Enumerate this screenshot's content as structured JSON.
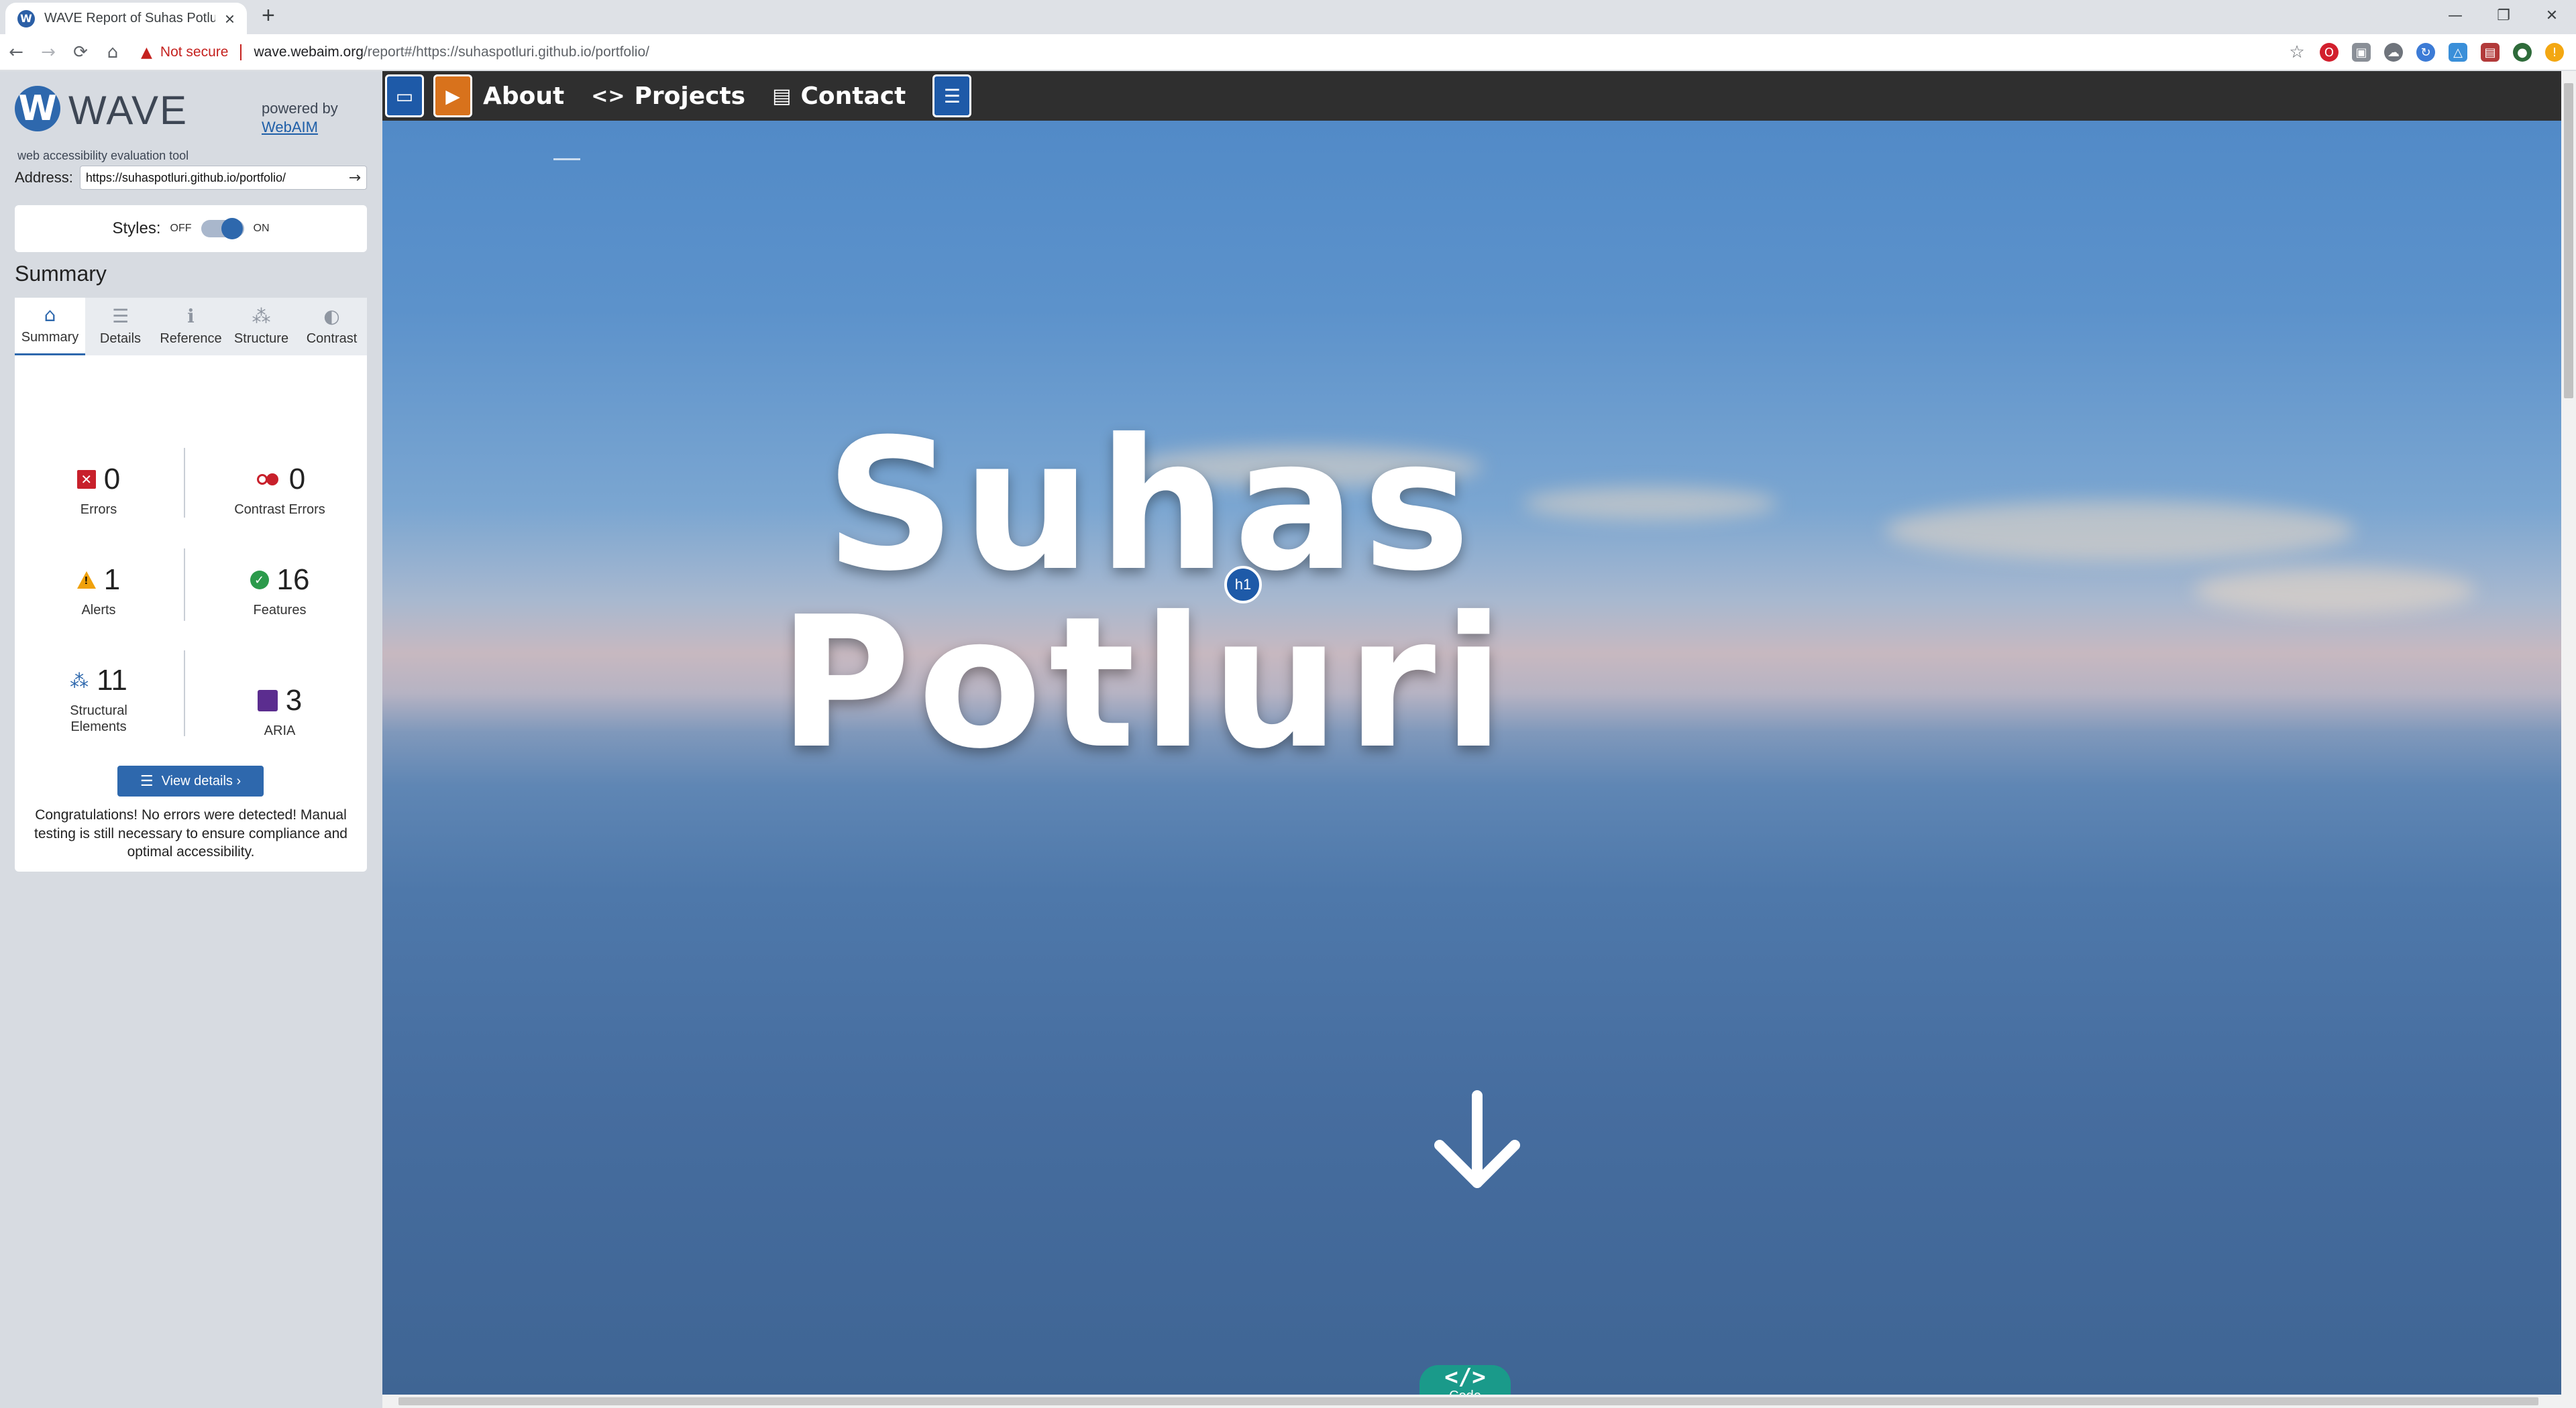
{
  "browser": {
    "tab_title": "WAVE Report of Suhas Potluri",
    "tab_favicon": "wave-favicon",
    "new_tab": "+",
    "security_label": "Not secure",
    "url_host": "wave.webaim.org",
    "url_rest": "/report#/https://suhaspotluri.github.io/portfolio/",
    "window_controls": [
      "—",
      "❐",
      "✕"
    ],
    "nav_icons": {
      "back": "←",
      "forward": "→",
      "reload": "⟳",
      "home": "⌂"
    }
  },
  "wave": {
    "logo_mark": "W",
    "logo_word": "WAVE",
    "logo_subtitle": "web accessibility evaluation tool",
    "powered_by": "powered by",
    "powered_link": "WebAIM",
    "address_label": "Address:",
    "address_value": "https://suhaspotluri.github.io/portfolio/",
    "go_icon": "→",
    "styles_label": "Styles:",
    "styles_off": "OFF",
    "styles_on": "ON",
    "styles_state": "on",
    "summary_heading": "Summary",
    "tabs": [
      {
        "label": "Summary",
        "icon": "⌂",
        "active": true
      },
      {
        "label": "Details",
        "icon": "☰",
        "active": false
      },
      {
        "label": "Reference",
        "icon": "ℹ",
        "active": false
      },
      {
        "label": "Structure",
        "icon": "⁂",
        "active": false
      },
      {
        "label": "Contrast",
        "icon": "◐",
        "active": false
      }
    ],
    "stats": {
      "errors": {
        "value": "0",
        "label": "Errors"
      },
      "contrast_errors": {
        "value": "0",
        "label": "Contrast Errors"
      },
      "alerts": {
        "value": "1",
        "label": "Alerts"
      },
      "features": {
        "value": "16",
        "label": "Features"
      },
      "structural": {
        "value": "11",
        "label_line1": "Structural",
        "label_line2": "Elements"
      },
      "aria": {
        "value": "3",
        "label": "ARIA"
      }
    },
    "view_details": "View details ›",
    "congrats": "Congratulations! No errors were detected! Manual testing is still necessary to ensure compliance and optimal accessibility."
  },
  "site": {
    "nav": [
      {
        "label": "About",
        "icon": ""
      },
      {
        "label": "Projects",
        "icon": "<>"
      },
      {
        "label": "Contact",
        "icon": "▤"
      }
    ],
    "hero_first": "Suhas",
    "hero_last": "Potluri",
    "h1_badge": "h1",
    "code_icon": "</>",
    "code_label": "Code"
  },
  "colors": {
    "wave_blue": "#2e68ad",
    "error_red": "#c8202b",
    "alert_orange": "#f0a10a",
    "feature_green": "#2b9a4b",
    "aria_purple": "#5b2d8f",
    "code_teal": "#1a9a8a"
  }
}
